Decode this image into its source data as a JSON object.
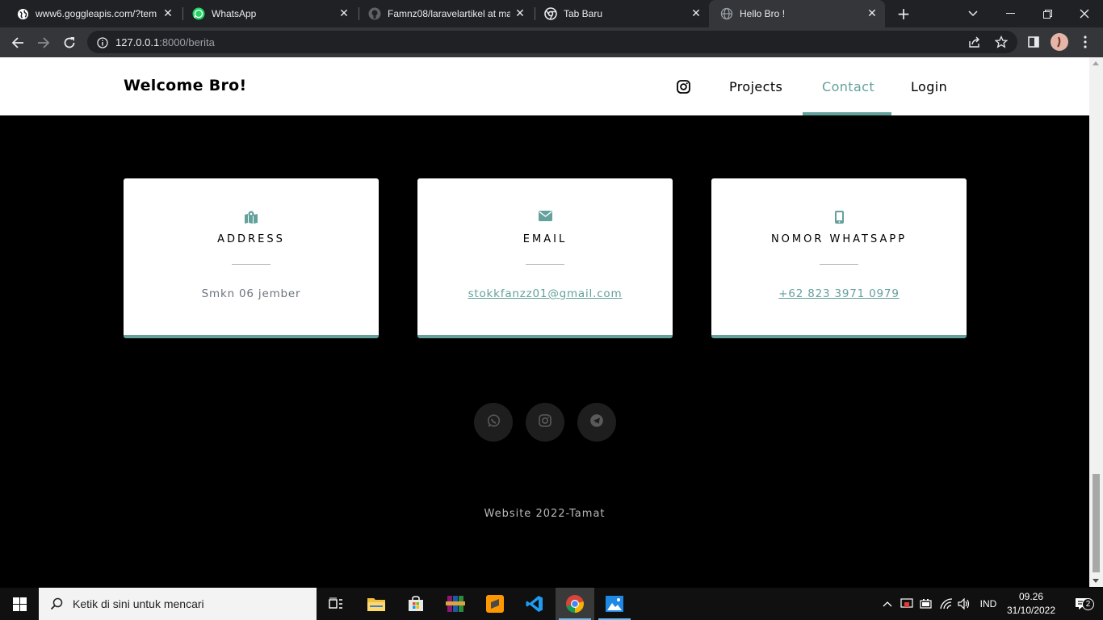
{
  "browser": {
    "tabs": [
      {
        "title": "www6.goggleapis.com/?tem",
        "icon": "globe-dark-icon"
      },
      {
        "title": "WhatsApp",
        "icon": "whatsapp-icon"
      },
      {
        "title": "Famnz08/laravelartikel at ma",
        "icon": "github-icon"
      },
      {
        "title": "Tab Baru",
        "icon": "chrome-icon"
      },
      {
        "title": "Hello Bro !",
        "icon": "globe-icon"
      }
    ],
    "active_tab": 4,
    "url_host": "127.0.0.1",
    "url_path": ":8000/berita"
  },
  "navbar": {
    "brand": "Welcome Bro!",
    "links": [
      {
        "label": "Projects",
        "active": false
      },
      {
        "label": "Contact",
        "active": true
      },
      {
        "label": "Login",
        "active": false
      }
    ]
  },
  "contact_cards": [
    {
      "icon": "map-marked-icon",
      "title": "ADDRESS",
      "value": "Smkn 06 jember",
      "is_link": false
    },
    {
      "icon": "envelope-icon",
      "title": "EMAIL",
      "value": "stokkfanzz01@gmail.com",
      "is_link": true
    },
    {
      "icon": "mobile-icon",
      "title": "NOMOR WHATSAPP",
      "value": "+62 823 3971 0979",
      "is_link": true
    }
  ],
  "social_links": [
    "whatsapp-icon",
    "instagram-icon",
    "telegram-icon"
  ],
  "footer": {
    "text": "Website 2022-Tamat"
  },
  "colors": {
    "accent": "#64a19d",
    "page_bg": "#000000",
    "card_bg": "#ffffff"
  },
  "taskbar": {
    "search_placeholder": "Ketik di sini untuk mencari",
    "language": "IND",
    "time": "09.26",
    "date": "31/10/2022",
    "notification_count": "2"
  }
}
